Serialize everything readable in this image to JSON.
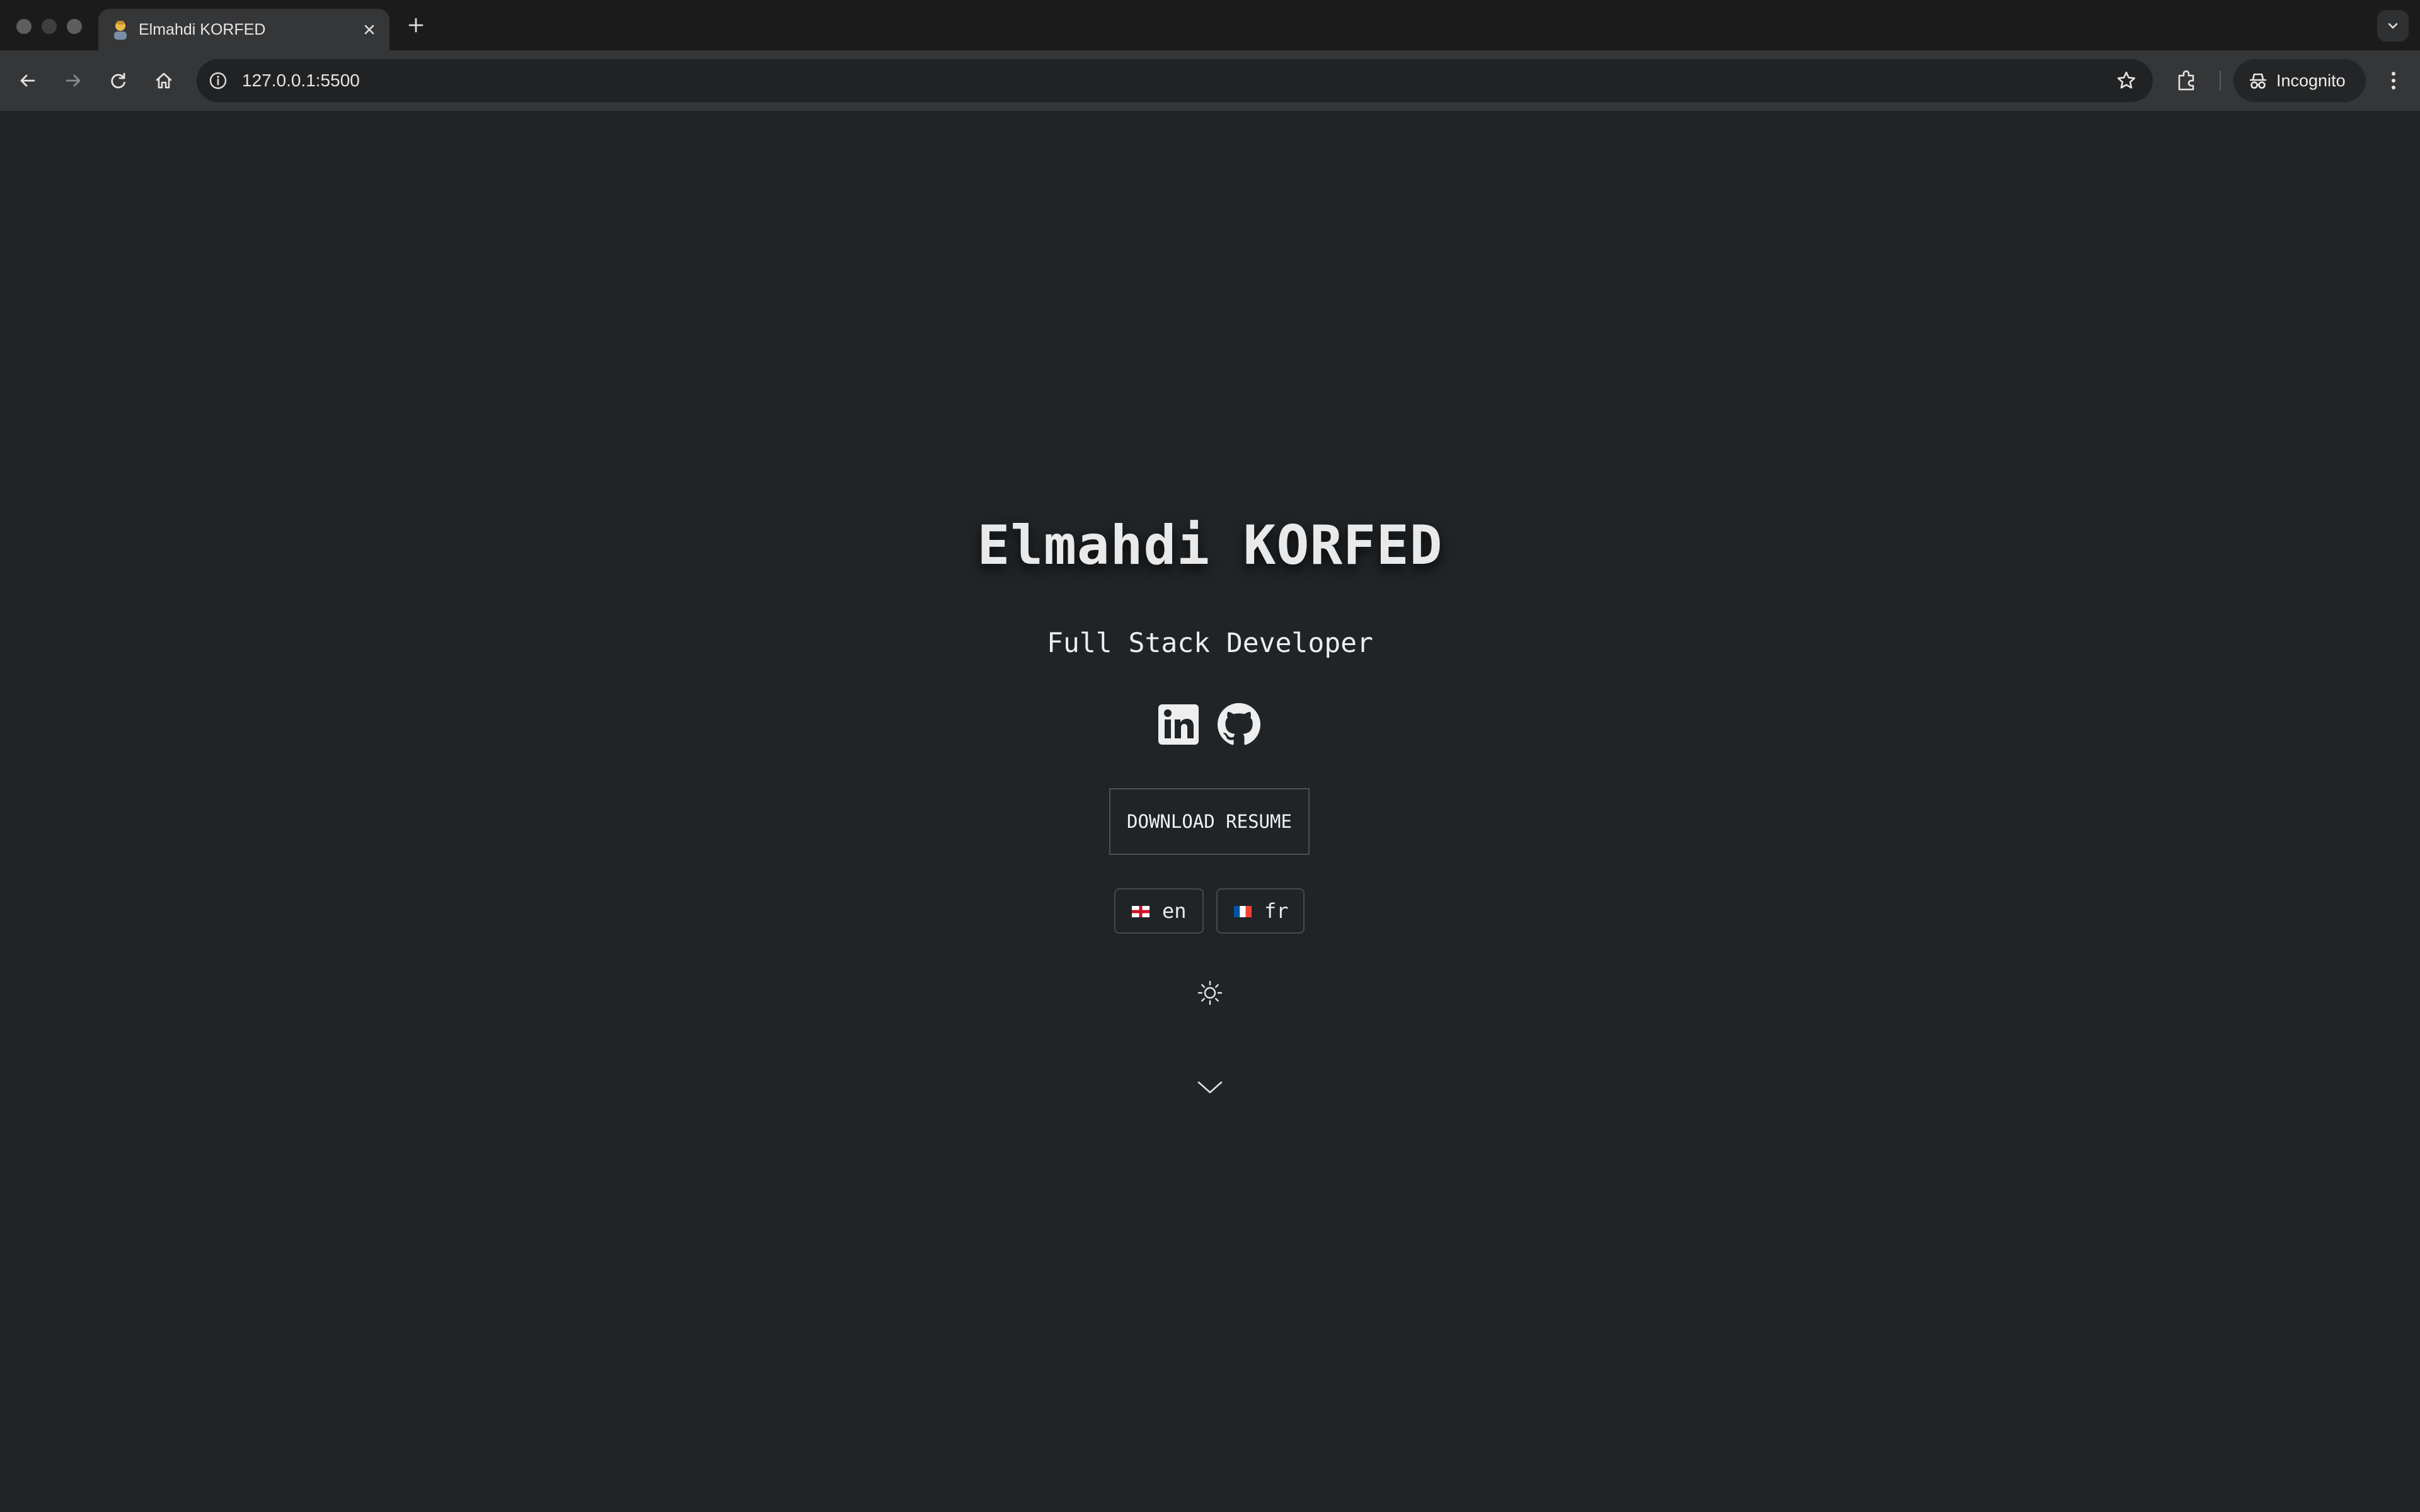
{
  "browser": {
    "tab": {
      "title": "Elmahdi KORFED",
      "favicon": "person-emoji-icon"
    },
    "url": "127.0.0.1:5500",
    "profile_label": "Incognito",
    "icons": [
      "back-arrow-icon",
      "forward-arrow-icon",
      "reload-icon",
      "home-icon",
      "info-icon",
      "star-icon",
      "extensions-icon",
      "incognito-icon",
      "more-vert-icon",
      "new-tab-plus-icon",
      "close-icon",
      "tab-search-chevron-icon"
    ]
  },
  "hero": {
    "name": "Elmahdi KORFED",
    "role": "Full Stack Developer",
    "socials": [
      {
        "name": "linkedin",
        "icon": "linkedin-icon"
      },
      {
        "name": "github",
        "icon": "github-icon"
      }
    ],
    "download_label": "DOWNLOAD RESUME",
    "languages": [
      {
        "code": "en",
        "label": "en",
        "flag": "england-flag-icon"
      },
      {
        "code": "fr",
        "label": "fr",
        "flag": "france-flag-icon"
      }
    ],
    "theme_icon": "sun-icon",
    "scroll_icon": "chevron-down-icon"
  },
  "colors": {
    "page_background": "#202427",
    "text": "#e9e9e9",
    "chrome_toolbar": "#353638",
    "chrome_tabstrip": "#1b1b1c"
  }
}
